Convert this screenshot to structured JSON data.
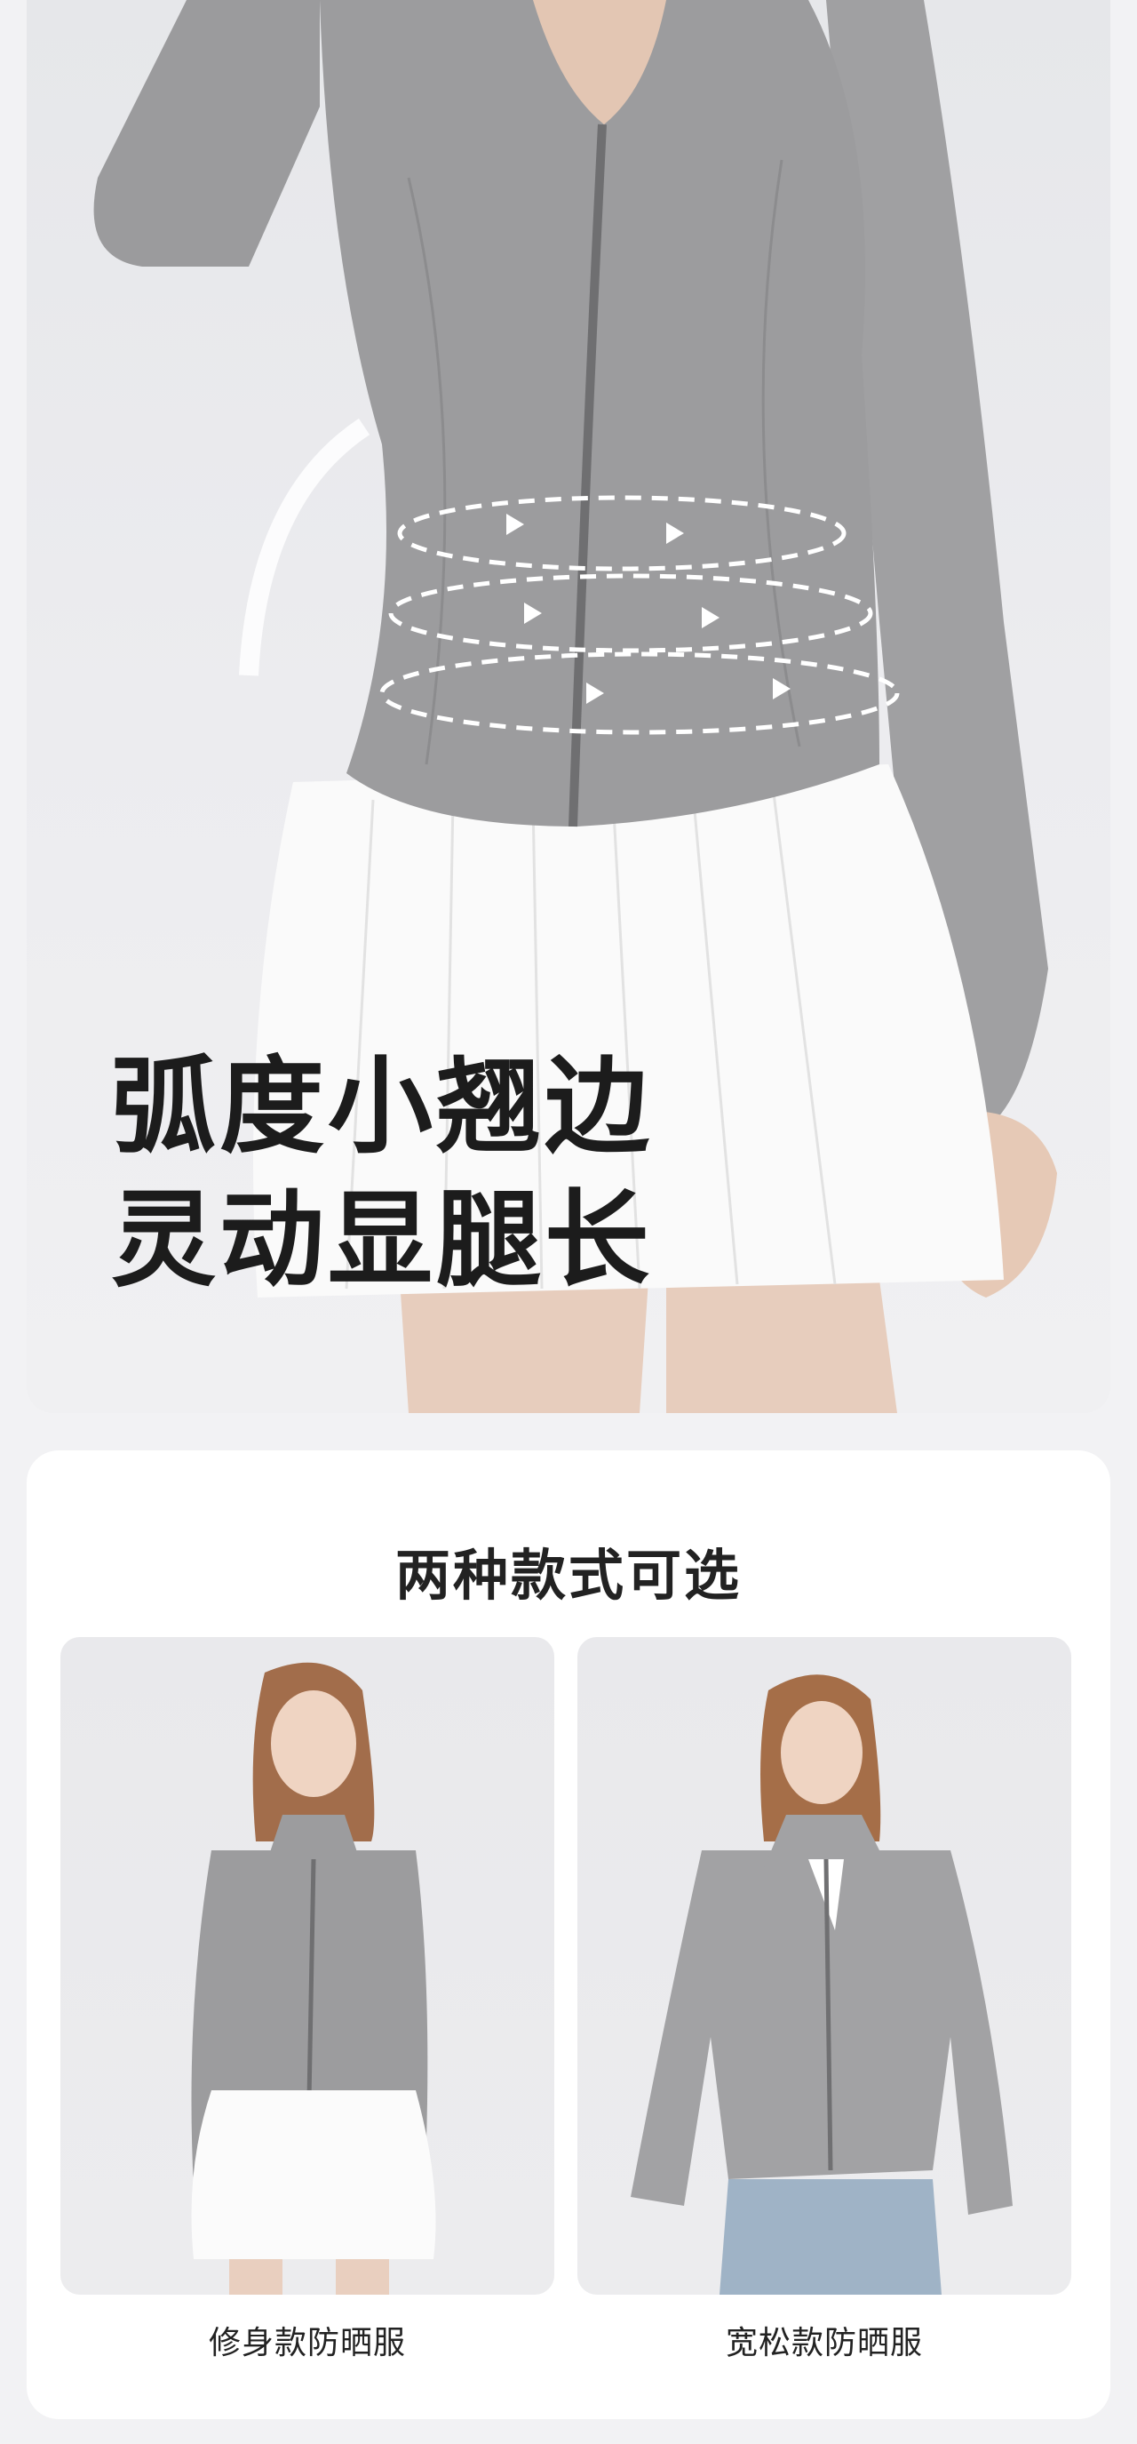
{
  "hero": {
    "headline_line1": "弧度小翘边",
    "headline_line2": "灵动显腿长"
  },
  "styles_section": {
    "title": "两种款式可选",
    "options": [
      {
        "label": "修身款防晒服",
        "image_icon": "slim-fit-jacket-photo"
      },
      {
        "label": "宽松款防晒服",
        "image_icon": "loose-fit-jacket-photo"
      }
    ]
  },
  "colors": {
    "jacket": "#9a9a9c",
    "skirt": "#fafafa",
    "background": "#f2f2f4",
    "text": "#1c1c1c"
  }
}
